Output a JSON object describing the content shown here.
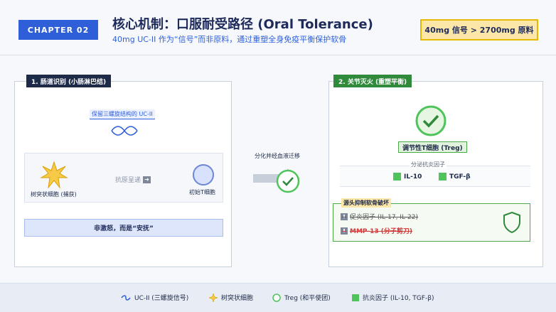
{
  "header": {
    "chapter": "CHAPTER 02",
    "title": "核心机制：口服耐受路径 (Oral Tolerance)",
    "subtitle": "40mg UC-II 作为“信号”而非原料，通过重塑全身免疫平衡保护软骨",
    "badge": "40mg 信号 > 2700mg 原料"
  },
  "left_panel": {
    "tag": "1. 肠道识别 (小肠淋巴结)",
    "uc_label": "保留三螺旋结构的 UC-II",
    "dendritic_label": "树突状细胞 (捕获)",
    "antigen_label": "抗原呈递",
    "naive_label": "初始T细胞",
    "calm_label": "非激怒，而是“安抚”"
  },
  "middle": {
    "label": "分化并经血液迁移"
  },
  "right_panel": {
    "tag": "2. 关节灭火 (重塑平衡)",
    "treg_label": "调节性T细胞 (Treg)",
    "secrete_label": "分泌抗炎因子",
    "cytokines": [
      "IL-10",
      "TGF-β"
    ],
    "inhibit_tag": "源头抑制软骨破坏",
    "inhibit_rows": [
      "促炎因子 (IL-17, IL-22)",
      "MMP-13 (分子剪刀)"
    ]
  },
  "legend": {
    "items": [
      "UC-II (三螺旋信号)",
      "树突状细胞",
      "Treg (和平使团)",
      "抗炎因子 (IL-10, TGF-β)"
    ]
  },
  "colors": {
    "accent": "#2f5fd8",
    "green": "#4fc45a",
    "red": "#d43a3a",
    "gold": "#e6b800"
  }
}
